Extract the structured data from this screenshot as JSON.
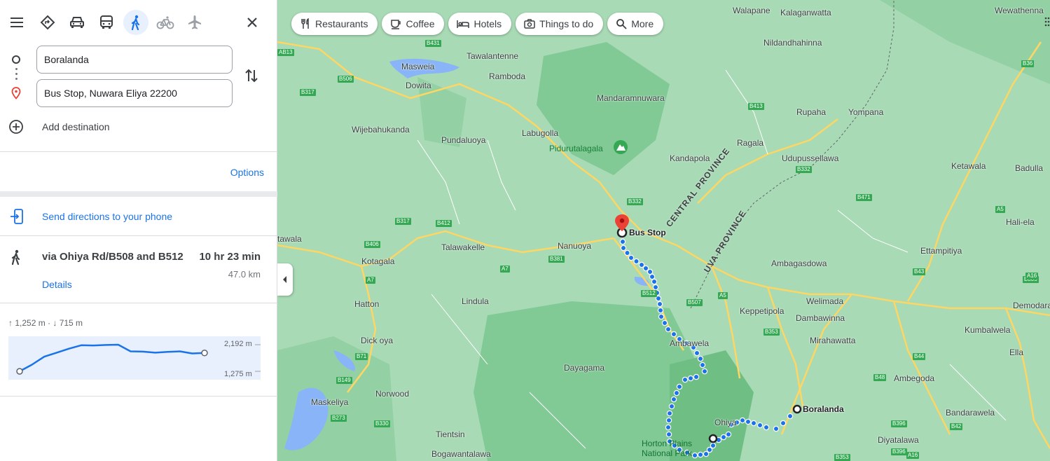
{
  "modes": {
    "menu": "menu-icon",
    "items": [
      "best-route-icon",
      "car-icon",
      "transit-icon",
      "walk-icon",
      "bike-icon",
      "flight-icon"
    ],
    "active": "walk-icon",
    "close": "close-icon"
  },
  "directions": {
    "origin_value": "Boralanda",
    "destination_value": "Bus Stop, Nuwara Eliya 22200",
    "add_destination": "Add destination",
    "options_label": "Options",
    "send_label": "Send directions to your phone"
  },
  "route": {
    "via": "via Ohiya Rd/B508 and B512",
    "time": "10 hr 23 min",
    "distance": "47.0 km",
    "details_label": "Details"
  },
  "elevation": {
    "stats": "↑ 1,252 m · ↓ 715 m",
    "max_label": "2,192 m",
    "min_label": "1,275 m",
    "profile": [
      0.0,
      0.25,
      0.55,
      0.7,
      0.85,
      0.98,
      0.97,
      0.99,
      1.0,
      0.75,
      0.74,
      0.7,
      0.73,
      0.75,
      0.67,
      0.69
    ]
  },
  "map": {
    "chips": [
      "Restaurants",
      "Coffee",
      "Hotels",
      "Things to do",
      "More"
    ],
    "chip_icons": [
      "restaurant-icon",
      "coffee-icon",
      "hotel-icon",
      "camera-icon",
      "search-icon"
    ],
    "places": [
      "Walapane",
      "Kalaganwatta",
      "Wewathenna",
      "Nildandhahinna",
      "Tawalantenne",
      "Masweia",
      "Ramboda",
      "Dowita",
      "Mandaramnuwara",
      "Rupaha",
      "Yompana",
      "Wijebahukanda",
      "Pundaluoya",
      "Labugolla",
      "Ragala",
      "Kandapola",
      "Udupussellawa",
      "Ketawala",
      "Badulla",
      "Hali-ela",
      "Ettampitiya",
      "Talawakelle",
      "Nanuoya",
      "Kotagala",
      "Ambagasdowa",
      "Keppetipola",
      "Welimada",
      "Dambawinna",
      "Kumbalwela",
      "Demodara",
      "Hatton",
      "Lindula",
      "Mirahawatta",
      "Ella",
      "Dick oya",
      "Ambawela",
      "Dayagama",
      "Ambegoda",
      "Maskeliya",
      "Norwood",
      "Bandarawela",
      "Ohiya",
      "Diyatalawa",
      "Tientsin",
      "Bogawantalawa",
      "tawala"
    ],
    "pois": [
      "Pidurutalagala"
    ],
    "route_endpoints": [
      "Bus Stop",
      "Boralanda"
    ],
    "park": "Horton Plains National Park",
    "provinces": [
      "CENTRAL PROVINCE",
      "UVA PROVINCE"
    ],
    "shields": [
      "AB13",
      "B431",
      "B506",
      "B317",
      "B413",
      "B332",
      "B471",
      "A5",
      "B36",
      "B317",
      "B412",
      "B406",
      "A7",
      "A7",
      "B381",
      "B512",
      "B507",
      "A5",
      "B43",
      "B805",
      "A16",
      "B353",
      "B71",
      "B44",
      "B48",
      "B149",
      "B273",
      "B330",
      "B396",
      "B42",
      "B396",
      "A16",
      "B353",
      "B332"
    ]
  },
  "colors": {
    "accent": "#1a73e8",
    "route_dot": "#1a73e8",
    "land": "#a8dab5",
    "forest": "#81c995",
    "roads": "#fdd663",
    "water": "#8ab4f8",
    "pin": "#ea4335"
  }
}
